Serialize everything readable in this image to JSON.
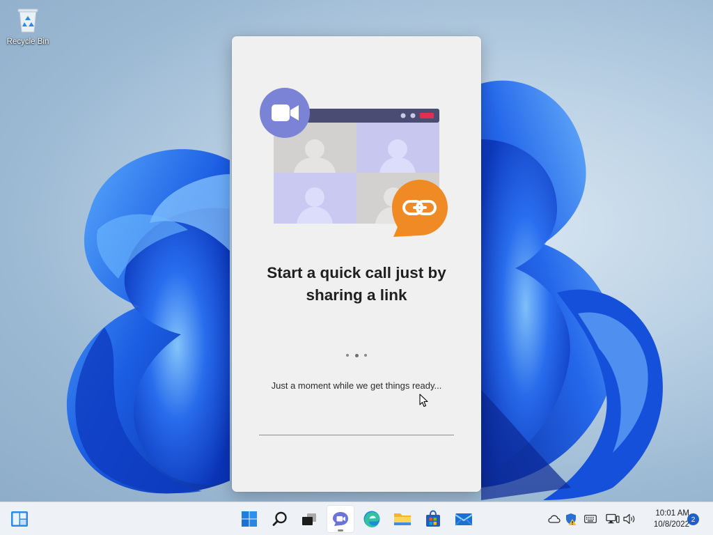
{
  "desktop": {
    "icons": [
      {
        "label": "Recycle Bin",
        "icon": "recycle-bin-icon"
      }
    ]
  },
  "splash": {
    "headline_line1": "Start a quick call just by",
    "headline_line2": "sharing a link",
    "status_text": "Just a moment while we get things ready...",
    "illustration": {
      "video_badge_icon": "video-camera-icon",
      "link_badge_icon": "link-icon",
      "video_badge_color": "#7b83d6",
      "link_badge_color": "#f08a24"
    }
  },
  "taskbar": {
    "pinned": [
      {
        "name": "Widgets",
        "icon": "widgets-icon"
      },
      {
        "name": "Start",
        "icon": "windows-start-icon"
      },
      {
        "name": "Search",
        "icon": "search-icon"
      },
      {
        "name": "Task View",
        "icon": "task-view-icon"
      },
      {
        "name": "Chat",
        "icon": "teams-chat-icon",
        "active": true
      },
      {
        "name": "Microsoft Edge",
        "icon": "edge-icon"
      },
      {
        "name": "File Explorer",
        "icon": "folder-icon"
      },
      {
        "name": "Microsoft Store",
        "icon": "store-icon"
      },
      {
        "name": "Mail",
        "icon": "mail-icon"
      }
    ],
    "tray": {
      "icons": [
        "onedrive-icon",
        "security-warning-icon",
        "keyboard-icon",
        "network-icon",
        "volume-icon"
      ],
      "time": "10:01 AM",
      "date": "10/8/2022",
      "notification_count": "2"
    }
  },
  "colors": {
    "accent": "#1f5fc8",
    "wallpaper_bloom": "#1a55e0"
  }
}
